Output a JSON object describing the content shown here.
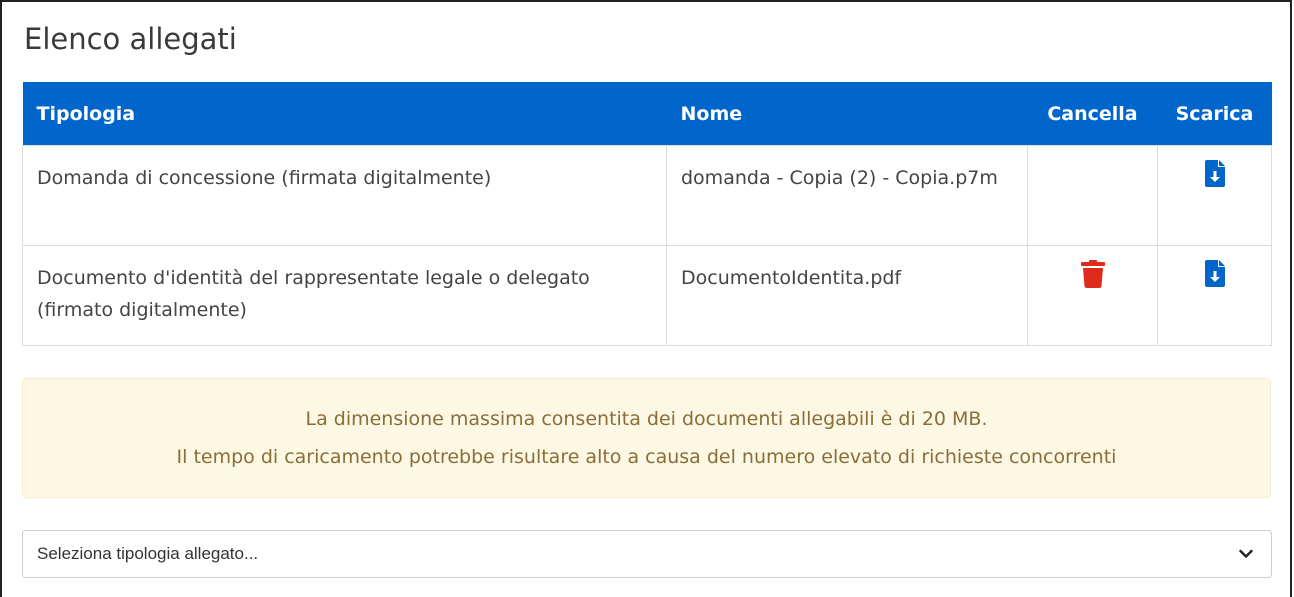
{
  "section": {
    "title": "Elenco allegati"
  },
  "table": {
    "headers": {
      "tipologia": "Tipologia",
      "nome": "Nome",
      "cancella": "Cancella",
      "scarica": "Scarica"
    },
    "rows": [
      {
        "tipologia": "Domanda di concessione (firmata digitalmente)",
        "nome": "domanda - Copia (2) - Copia.p7m",
        "can_delete": false
      },
      {
        "tipologia": "Documento d'identità del rappresentate legale o delegato (firmato digitalmente)",
        "nome": "DocumentoIdentita.pdf",
        "can_delete": true
      }
    ],
    "icons": {
      "download": "file-download-icon",
      "delete": "trash-icon"
    }
  },
  "alert": {
    "line1": "La dimensione massima consentita dei documenti allegabili è di 20 MB.",
    "line2": "Il tempo di caricamento potrebbe risultare alto a causa del numero elevato di richieste concorrenti"
  },
  "select": {
    "value": "Seleziona tipologia allegato..."
  },
  "colors": {
    "header": "#0066cc",
    "delete": "#dd2a1b",
    "download": "#0066cc",
    "alert_bg": "#fcf8e3",
    "alert_text": "#8a6d3b"
  }
}
